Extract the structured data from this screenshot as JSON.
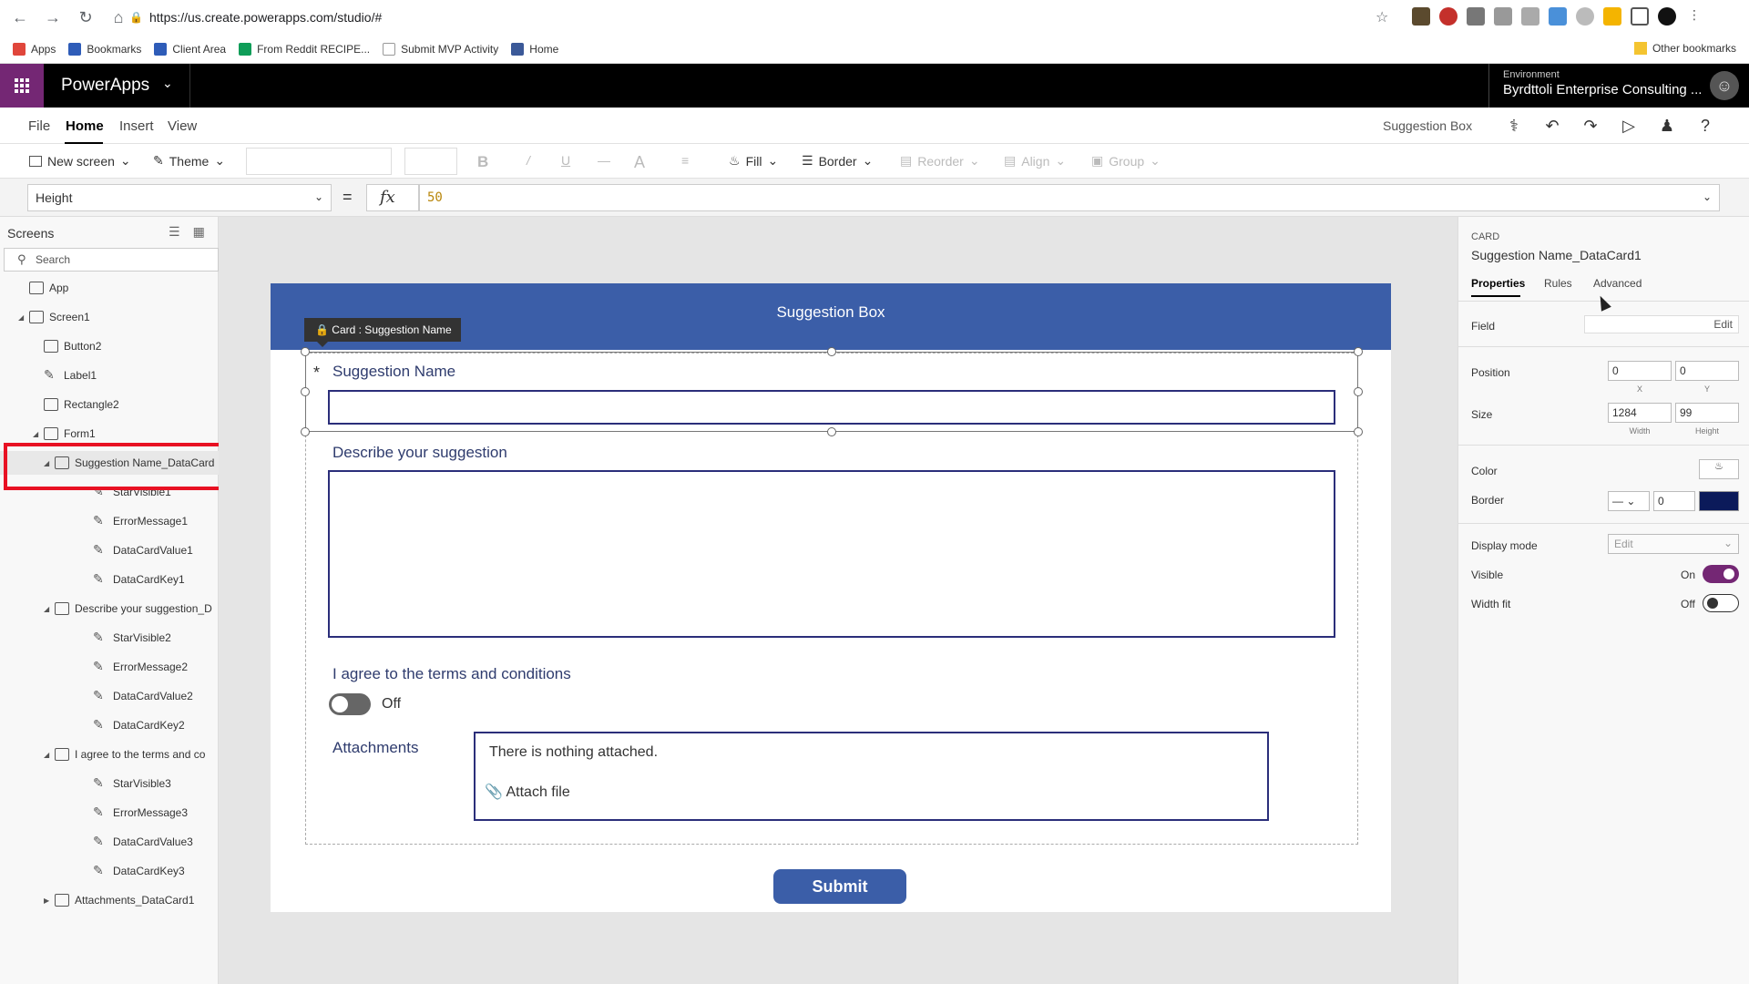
{
  "browser": {
    "url": "https://us.create.powerapps.com/studio/#",
    "bookmarks": [
      {
        "label": "Apps",
        "color": "#e0463b"
      },
      {
        "label": "Bookmarks",
        "color": "#2e5cb8"
      },
      {
        "label": "Client Area",
        "color": "#2e5cb8"
      },
      {
        "label": "From Reddit RECIPE...",
        "color": "#0f9d58"
      },
      {
        "label": "Submit MVP Activity",
        "color": "#999999"
      },
      {
        "label": "Home",
        "color": "#3b5998"
      }
    ],
    "other_bookmarks": "Other bookmarks"
  },
  "header": {
    "app_name": "PowerApps",
    "env_label": "Environment",
    "env_value": "Byrdttoli Enterprise Consulting ..."
  },
  "menu": {
    "items": [
      "File",
      "Home",
      "Insert",
      "View"
    ],
    "active": "Home",
    "screen_name": "Suggestion Box"
  },
  "ribbon": {
    "new_screen": "New screen",
    "theme": "Theme",
    "bold": "B",
    "italic": "/",
    "underline": "U",
    "strike": "—",
    "font_color": "A",
    "fill": "Fill",
    "border": "Border",
    "reorder": "Reorder",
    "align": "Align",
    "group": "Group"
  },
  "formula": {
    "property": "Height",
    "equals": "=",
    "fx": "fx",
    "value": "50"
  },
  "tree": {
    "title": "Screens",
    "search_placeholder": "Search",
    "items": [
      {
        "label": "App",
        "level": 0
      },
      {
        "label": "Screen1",
        "level": 0
      },
      {
        "label": "Button2",
        "level": 1
      },
      {
        "label": "Label1",
        "level": 1
      },
      {
        "label": "Rectangle2",
        "level": 1
      },
      {
        "label": "Form1",
        "level": 1
      },
      {
        "label": "Suggestion Name_DataCard",
        "level": 2
      },
      {
        "label": "StarVisible1",
        "level": 3
      },
      {
        "label": "ErrorMessage1",
        "level": 3
      },
      {
        "label": "DataCardValue1",
        "level": 3
      },
      {
        "label": "DataCardKey1",
        "level": 3
      },
      {
        "label": "Describe your suggestion_D",
        "level": 2
      },
      {
        "label": "StarVisible2",
        "level": 3
      },
      {
        "label": "ErrorMessage2",
        "level": 3
      },
      {
        "label": "DataCardValue2",
        "level": 3
      },
      {
        "label": "DataCardKey2",
        "level": 3
      },
      {
        "label": "I agree to the terms and co",
        "level": 2
      },
      {
        "label": "StarVisible3",
        "level": 3
      },
      {
        "label": "ErrorMessage3",
        "level": 3
      },
      {
        "label": "DataCardValue3",
        "level": 3
      },
      {
        "label": "DataCardKey3",
        "level": 3
      },
      {
        "label": "Attachments_DataCard1",
        "level": 2
      }
    ]
  },
  "canvas": {
    "header_title": "Suggestion Box",
    "card_tag": "Card : Suggestion Name",
    "required_star": "*",
    "field1_label": "Suggestion Name",
    "field2_label": "Describe your suggestion",
    "field3_label": "I agree to the terms and conditions",
    "toggle_text": "Off",
    "attachments_label": "Attachments",
    "attach_empty": "There is nothing attached.",
    "attach_link": "Attach file",
    "submit_label": "Submit"
  },
  "properties": {
    "type": "CARD",
    "name": "Suggestion Name_DataCard1",
    "tabs": [
      "Properties",
      "Rules",
      "Advanced"
    ],
    "field_label": "Field",
    "field_edit": "Edit",
    "position_label": "Position",
    "position_x": "0",
    "position_y": "0",
    "x_label": "X",
    "y_label": "Y",
    "size_label": "Size",
    "width": "1284",
    "height": "99",
    "width_label": "Width",
    "height_label": "Height",
    "color_label": "Color",
    "border_label": "Border",
    "border_width": "0",
    "border_color": "#0b1a5a",
    "display_mode_label": "Display mode",
    "display_mode_value": "Edit",
    "visible_label": "Visible",
    "visible_value": "On",
    "width_fit_label": "Width fit",
    "width_fit_value": "Off"
  }
}
